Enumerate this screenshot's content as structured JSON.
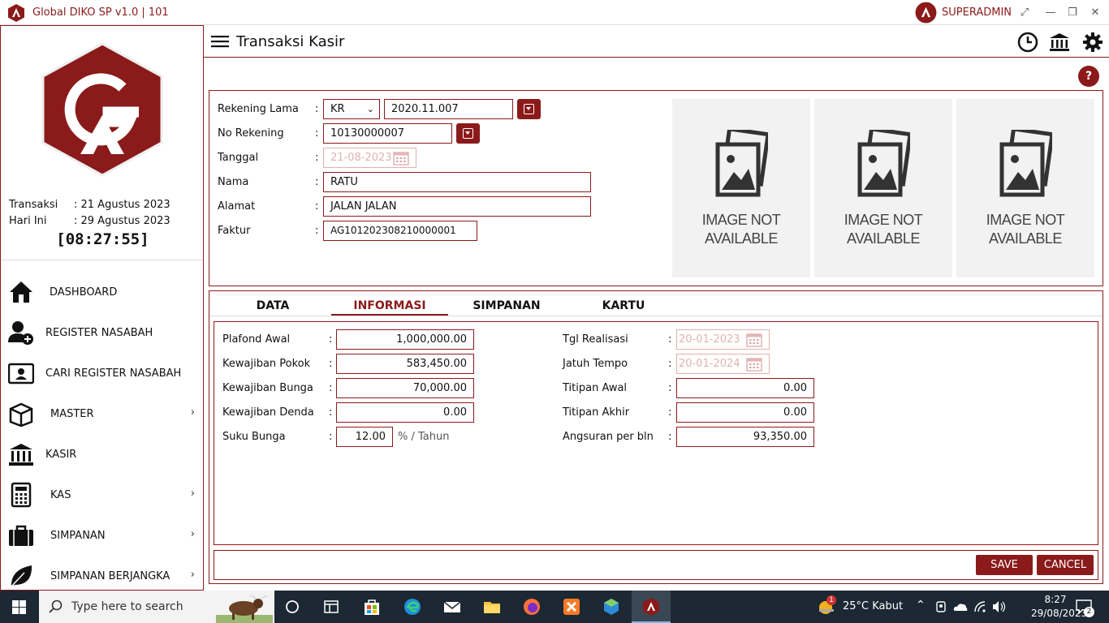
{
  "window": {
    "title": "Global DIKO SP v1.0 | 101",
    "user": "SUPERADMIN"
  },
  "sidebar": {
    "transaksi_label": "Transaksi",
    "transaksi_value": ": 21 Agustus 2023",
    "hariini_label": "Hari Ini",
    "hariini_value": ": 29 Agustus 2023",
    "clock": "[08:27:55]",
    "items": [
      {
        "label": "DASHBOARD",
        "icon": "home-icon"
      },
      {
        "label": "REGISTER NASABAH",
        "icon": "add-user-icon"
      },
      {
        "label": "CARI REGISTER NASABAH",
        "icon": "id-card-icon"
      },
      {
        "label": "MASTER",
        "icon": "box-icon"
      },
      {
        "label": "KASIR",
        "icon": "bank-icon"
      },
      {
        "label": "KAS",
        "icon": "calculator-icon"
      },
      {
        "label": "SIMPANAN",
        "icon": "briefcase-icon"
      },
      {
        "label": "SIMPANAN BERJANGKA",
        "icon": "leaf-icon"
      }
    ]
  },
  "header": {
    "title": "Transaksi Kasir"
  },
  "form": {
    "rekening_lama_label": "Rekening Lama",
    "rekening_lama_type": "KR",
    "rekening_lama_value": "2020.11.007",
    "no_rekening_label": "No Rekening",
    "no_rekening_value": "10130000007",
    "tanggal_label": "Tanggal",
    "tanggal_value": "21-08-2023",
    "nama_label": "Nama",
    "nama_value": "RATU",
    "alamat_label": "Alamat",
    "alamat_value": "JALAN JALAN",
    "faktur_label": "Faktur",
    "faktur_value": "AG101202308210000001",
    "colon": ":"
  },
  "images": {
    "placeholder_line1": "IMAGE NOT",
    "placeholder_line2": "AVAILABLE"
  },
  "tabs": [
    "DATA",
    "INFORMASI",
    "SIMPANAN",
    "KARTU"
  ],
  "informasi": {
    "plafond_awal_label": "Plafond Awal",
    "plafond_awal": "1,000,000.00",
    "kewajiban_pokok_label": "Kewajiban Pokok",
    "kewajiban_pokok": "583,450.00",
    "kewajiban_bunga_label": "Kewajiban Bunga",
    "kewajiban_bunga": "70,000.00",
    "kewajiban_denda_label": "Kewajiban Denda",
    "kewajiban_denda": "0.00",
    "suku_bunga_label": "Suku Bunga",
    "suku_bunga": "12.00",
    "suku_bunga_unit": "% / Tahun",
    "tgl_realisasi_label": "Tgl Realisasi",
    "tgl_realisasi": "20-01-2023",
    "jatuh_tempo_label": "Jatuh Tempo",
    "jatuh_tempo": "20-01-2024",
    "titipan_awal_label": "Titipan Awal",
    "titipan_awal": "0.00",
    "titipan_akhir_label": "Titipan Akhir",
    "titipan_akhir": "0.00",
    "angsuran_label": "Angsuran per bln",
    "angsuran": "93,350.00"
  },
  "actions": {
    "save": "SAVE",
    "cancel": "CANCEL"
  },
  "taskbar": {
    "search_placeholder": "Type here to search",
    "weather": "25°C  Kabut",
    "weather_badge": "1",
    "time": "8:27",
    "date": "29/08/2023",
    "notif_count": "2"
  },
  "colors": {
    "accent": "#8b1a1a",
    "taskbar": "#1c2833"
  }
}
